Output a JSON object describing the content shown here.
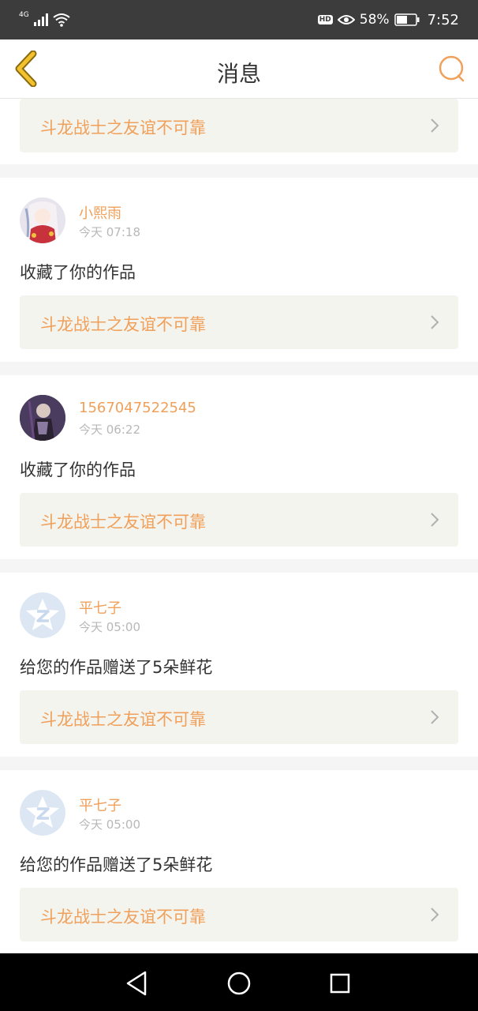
{
  "status_bar": {
    "network": "4G",
    "battery": "58%",
    "time": "7:52",
    "hd": "HD"
  },
  "header": {
    "title": "消息",
    "back_icon": "chevron-left-icon",
    "search_icon": "search-icon"
  },
  "colors": {
    "accent": "#f0a05a",
    "card_bg": "#f4f4ef",
    "text": "#333333",
    "muted": "#b8b8b8"
  },
  "notifications": [
    {
      "card_title": "斗龙战士之友谊不可靠"
    },
    {
      "user": "小熙雨",
      "time": "今天 07:18",
      "action": "收藏了你的作品",
      "card_title": "斗龙战士之友谊不可靠",
      "avatar": "anime-avatar"
    },
    {
      "user": "1567047522545",
      "time": "今天 06:22",
      "action": "收藏了你的作品",
      "card_title": "斗龙战士之友谊不可靠",
      "avatar": "character-avatar"
    },
    {
      "user": "平七子",
      "time": "今天 05:00",
      "action": "给您的作品赠送了5朵鲜花",
      "card_title": "斗龙战士之友谊不可靠",
      "avatar": "default-star-avatar"
    },
    {
      "user": "平七子",
      "time": "今天 05:00",
      "action": "给您的作品赠送了5朵鲜花",
      "card_title": "斗龙战士之友谊不可靠",
      "avatar": "default-star-avatar"
    }
  ],
  "nav_bar": {
    "back": "back-triangle-icon",
    "home": "home-circle-icon",
    "recents": "recents-square-icon"
  }
}
